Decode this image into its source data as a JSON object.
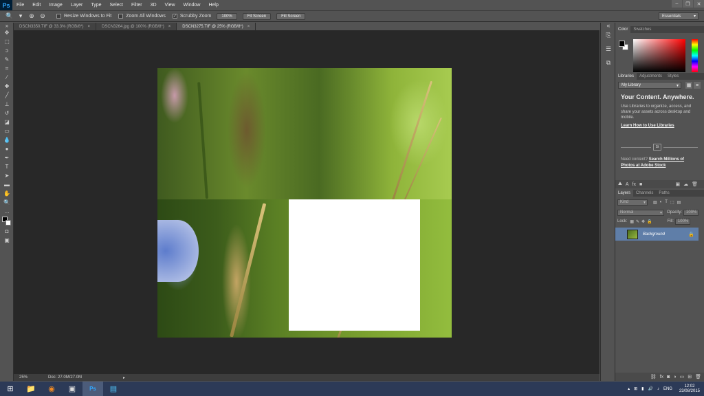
{
  "app": {
    "logo": "Ps"
  },
  "menu": [
    "File",
    "Edit",
    "Image",
    "Layer",
    "Type",
    "Select",
    "Filter",
    "3D",
    "View",
    "Window",
    "Help"
  ],
  "options": {
    "resize_windows": "Resize Windows to Fit",
    "zoom_all": "Zoom All Windows",
    "scrubby": "Scrubby Zoom",
    "btn_100": "100%",
    "btn_fit": "Fit Screen",
    "btn_fill": "Fill Screen",
    "workspace": "Essentials"
  },
  "tabs": [
    {
      "label": "DSCN3350.TIF @ 33.3% (RGB/8*)",
      "active": false
    },
    {
      "label": "DSCN3264.jpg @ 100% (RGB/8*)",
      "active": false
    },
    {
      "label": "DSCN3275.TIF @ 25% (RGB/8*)",
      "active": true
    }
  ],
  "status": {
    "zoom": "25%",
    "doc": "Doc: 27.0M/27.0M"
  },
  "panels": {
    "color_tabs": [
      "Color",
      "Swatches"
    ],
    "lib_tabs": [
      "Libraries",
      "Adjustments",
      "Styles"
    ],
    "library_select": "My Library",
    "lib_heading": "Your Content. Anywhere.",
    "lib_body": "Use Libraries to organize, access, and share your assets across desktop and mobile.",
    "lib_link": "Learn How to Use Libraries",
    "lib_st": "St",
    "lib_need": "Need content?",
    "lib_need_link": "Search Millions of Photos at Adobe Stock",
    "layers_tabs": [
      "Layers",
      "Channels",
      "Paths"
    ],
    "kind": "Kind",
    "blend": "Normal",
    "opacity_label": "Opacity:",
    "opacity_value": "100%",
    "lock_label": "Lock:",
    "fill_label": "Fill:",
    "fill_value": "100%",
    "layer_name": "Background"
  },
  "taskbar": {
    "lang": "ENG",
    "time": "12:02",
    "date": "23/08/2015"
  }
}
